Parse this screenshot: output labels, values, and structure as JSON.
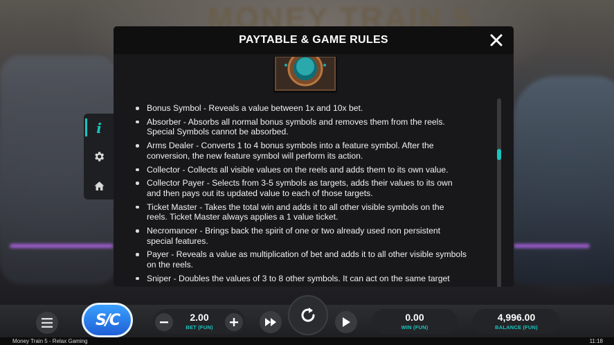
{
  "background": {
    "game_title": "MONEY TRAIN 5"
  },
  "side_menu": {
    "items": [
      {
        "icon": "info-icon",
        "active": true
      },
      {
        "icon": "gear-icon",
        "active": false
      },
      {
        "icon": "home-icon",
        "active": false
      }
    ]
  },
  "modal": {
    "title": "PAYTABLE & GAME RULES",
    "rules": [
      "Bonus Symbol - Reveals a value between 1x and 10x bet.",
      "Absorber - Absorbs all normal bonus symbols and removes them from the reels. Special Symbols cannot be absorbed.",
      "Arms Dealer - Converts 1 to 4 bonus symbols into a feature symbol. After the conversion, the new feature symbol will perform its action.",
      "Collector - Collects all visible values on the reels and adds them to its own value.",
      "Collector Payer - Selects from 3-5 symbols as targets, adds their values to its own and then pays out its updated value to each of those targets.",
      "Ticket Master - Takes the total win and adds it to all other visible symbols on the reels. Ticket Master always applies a 1 value ticket.",
      "Necromancer - Brings back the spirit of one or two already used non persistent special features.",
      "Payer - Reveals a value as multiplication of bet and adds it to all other visible symbols on the reels.",
      "Sniper - Doubles the values of 3 to 8 other symbols. It can act on the same target"
    ]
  },
  "bottom_bar": {
    "logo_text": "S/C",
    "bet": {
      "value": "2.00",
      "label": "BET (FUN)"
    },
    "win": {
      "value": "0.00",
      "label": "WIN (FUN)"
    },
    "balance": {
      "value": "4,996.00",
      "label": "BALANCE (FUN)"
    }
  },
  "status_bar": {
    "game_name": "Money Train 5 - Relax Gaming",
    "time": "11:18"
  },
  "colors": {
    "accent": "#19c6c0",
    "modal_bg": "#18181a"
  }
}
